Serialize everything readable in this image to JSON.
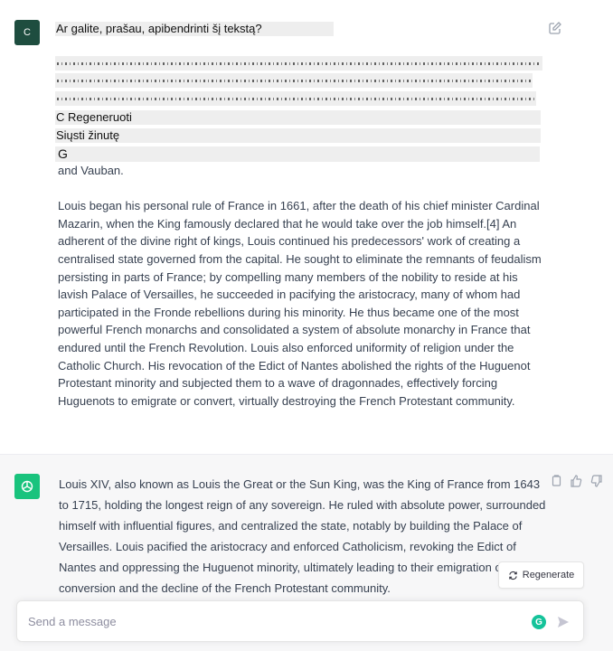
{
  "user": {
    "avatar_letter": "C",
    "prompt": "Ar galite, prašau, apibendrinti šį tekstą?",
    "overlay_lines": [
      "C Regeneruoti",
      "Siųsti žinutę",
      "G"
    ],
    "paragraphs": [
      "and Vauban.",
      "Louis began his personal rule of France in 1661, after the death of his chief minister Cardinal Mazarin, when the King famously declared that he would take over the job himself.[4] An adherent of the divine right of kings, Louis continued his predecessors' work of creating a centralised state governed from the capital. He sought to eliminate the remnants of feudalism persisting in parts of France; by compelling many members of the nobility to reside at his lavish Palace of Versailles, he succeeded in pacifying the aristocracy, many of whom had participated in the Fronde rebellions during his minority. He thus became one of the most powerful French monarchs and consolidated a system of absolute monarchy in France that endured until the French Revolution. Louis also enforced uniformity of religion under the Catholic Church. His revocation of the Edict of Nantes abolished the rights of the Huguenot Protestant minority and subjected them to a wave of dragonnades, effectively forcing Huguenots to emigrate or convert, virtually destroying the French Protestant community."
    ]
  },
  "assistant": {
    "response": "Louis XIV, also known as Louis the Great or the Sun King, was the King of France from 1643 to 1715, holding the longest reign of any sovereign. He ruled with absolute power, surrounded himself with influential figures, and centralized the state, notably by building the Palace of Versailles. Louis pacified the aristocracy and enforced Catholicism, revoking the Edict of Nantes and oppressing the Huguenot minority, ultimately leading to their emigration or conversion and the decline of the French Protestant community."
  },
  "regenerate_label": "Regenerate",
  "composer": {
    "placeholder": "Send a message",
    "extension_letter": "G"
  },
  "icons": [
    "edit-icon",
    "openai-logo-icon",
    "copy-icon",
    "thumbs-up-icon",
    "thumbs-down-icon",
    "refresh-icon",
    "send-icon"
  ],
  "colors": {
    "user_avatar": "#1e4d3f",
    "assistant_avatar": "#19c37d",
    "assistant_background": "#f7f7f8",
    "text": "#374151"
  }
}
